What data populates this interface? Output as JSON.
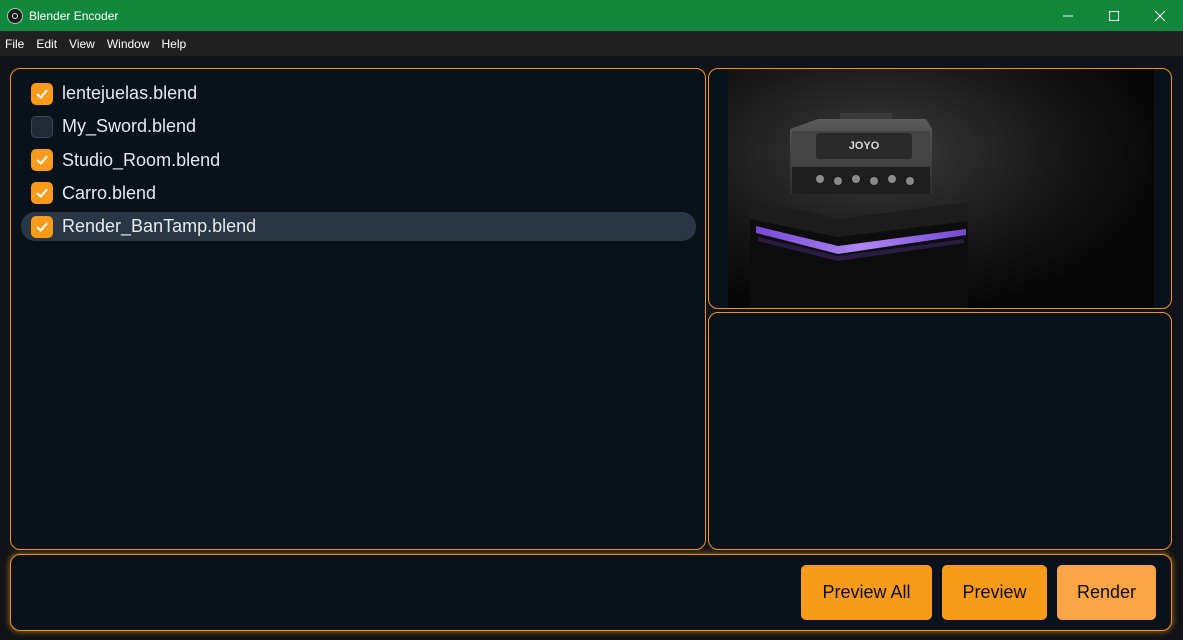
{
  "window": {
    "title": "Blender Encoder",
    "icon": "blender-encoder-app-icon"
  },
  "menu": [
    "File",
    "Edit",
    "View",
    "Window",
    "Help"
  ],
  "files": [
    {
      "name": "lentejuelas.blend",
      "checked": true,
      "selected": false
    },
    {
      "name": "My_Sword.blend",
      "checked": false,
      "selected": false
    },
    {
      "name": "Studio_Room.blend",
      "checked": true,
      "selected": false
    },
    {
      "name": "Carro.blend",
      "checked": true,
      "selected": false
    },
    {
      "name": "Render_BanTamp.blend",
      "checked": true,
      "selected": true
    }
  ],
  "preview": {
    "logo_text": "JOYO"
  },
  "actions": {
    "preview_all": "Preview All",
    "preview": "Preview",
    "render": "Render"
  },
  "colors": {
    "titlebar": "#11883c",
    "accent": "#f89b1b",
    "panel_bg": "#09111b",
    "panel_border": "#ef9420",
    "selected_row": "#283645"
  }
}
